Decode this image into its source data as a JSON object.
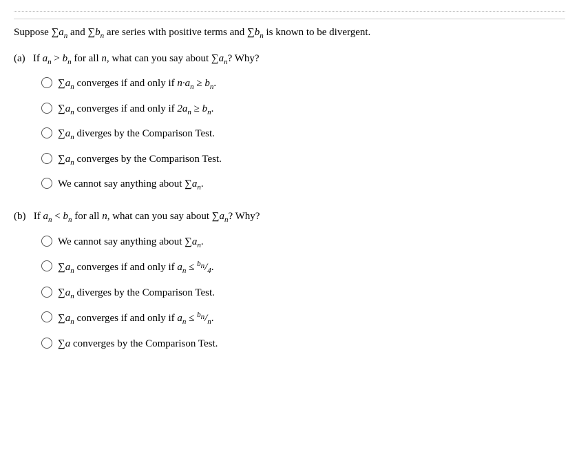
{
  "header": {
    "intro": "Suppose",
    "sum_a": "∑a",
    "sub_n1": "n",
    "and": "and",
    "sum_b": "∑b",
    "sub_n2": "n",
    "rest": "are series with positive terms and",
    "sum_b2": "∑b",
    "sub_n3": "n",
    "known": "is known to be divergent."
  },
  "part_a": {
    "label": "(a)",
    "question": "If a",
    "sub_n": "n",
    "gt": "> b",
    "sub_b": "n",
    "rest": "for all n, what can you say about",
    "sum": "∑",
    "a_n": "a",
    "sub_an": "n",
    "why": "? Why?",
    "options": [
      {
        "id": "a1",
        "text_parts": [
          "∑a",
          "n",
          " converges if and only if n·a",
          "n",
          " ≥ b",
          "n",
          "."
        ]
      },
      {
        "id": "a2",
        "text_parts": [
          "∑a",
          "n",
          " converges if and only if 2a",
          "n",
          " ≥ b",
          "n",
          "."
        ]
      },
      {
        "id": "a3",
        "text_parts": [
          "∑a",
          "n",
          " diverges by the Comparison Test."
        ]
      },
      {
        "id": "a4",
        "text_parts": [
          "∑a",
          "n",
          " converges by the Comparison Test."
        ]
      },
      {
        "id": "a5",
        "text_parts": [
          "We cannot say anything about ∑a",
          "n",
          "."
        ]
      }
    ]
  },
  "part_b": {
    "label": "(b)",
    "question": "If a",
    "sub_n": "n",
    "lt": "< b",
    "sub_b": "n",
    "rest": "for all n, what can you say about",
    "sum": "∑",
    "a_n": "a",
    "sub_an": "n",
    "why": "? Why?",
    "options": [
      {
        "id": "b1",
        "text_parts": [
          "We cannot say anything about ∑a",
          "n",
          "."
        ]
      },
      {
        "id": "b2",
        "text_parts": [
          "∑a",
          "n",
          " converges if and only if a",
          "n",
          " ≤ b",
          "n",
          "/4."
        ]
      },
      {
        "id": "b3",
        "text_parts": [
          "∑a",
          "n",
          " diverges by the Comparison Test."
        ]
      },
      {
        "id": "b4",
        "text_parts": [
          "∑a",
          "n",
          " converges if and only if a",
          "n",
          " ≤ b",
          "n",
          "/n."
        ]
      },
      {
        "id": "b5",
        "text_parts": [
          "∑a converges by the Comparison Test."
        ]
      }
    ]
  }
}
